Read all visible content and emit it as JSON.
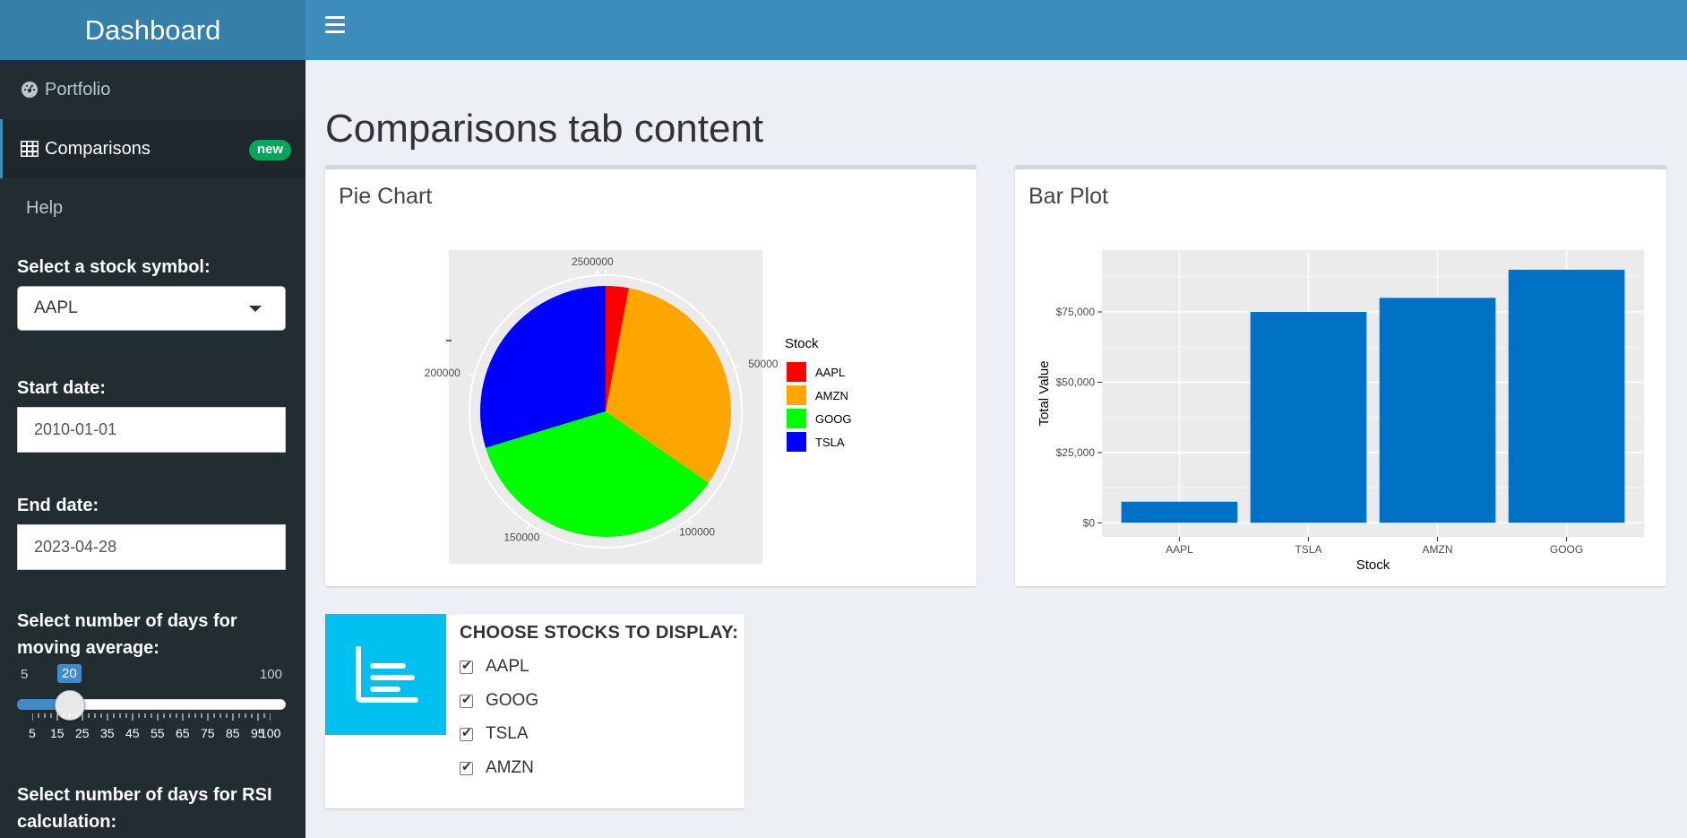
{
  "header": {
    "app_title": "Dashboard"
  },
  "sidebar": {
    "menu": [
      {
        "label": "Portfolio",
        "icon": "dashboard-icon"
      },
      {
        "label": "Comparisons",
        "icon": "table-icon",
        "badge": "new",
        "active": true
      },
      {
        "label": "Help"
      }
    ],
    "stock_select": {
      "label": "Select a stock symbol:",
      "value": "AAPL"
    },
    "start_date": {
      "label": "Start date:",
      "value": "2010-01-01"
    },
    "end_date": {
      "label": "End date:",
      "value": "2023-04-28"
    },
    "ma_slider": {
      "label": "Select number of days for moving average:",
      "min": "5",
      "max": "100",
      "value": "20",
      "ticks": [
        "5",
        "15",
        "25",
        "35",
        "45",
        "55",
        "65",
        "75",
        "85",
        "95",
        "100"
      ]
    },
    "rsi_label": "Select number of days for RSI calculation:"
  },
  "main": {
    "page_title": "Comparisons tab content",
    "pie_box": {
      "title": "Pie Chart"
    },
    "bar_box": {
      "title": "Bar Plot"
    },
    "choose_box": {
      "title": "CHOOSE STOCKS TO DISPLAY:",
      "icon": "list-icon",
      "options": [
        {
          "label": "AAPL",
          "checked": true
        },
        {
          "label": "GOOG",
          "checked": true
        },
        {
          "label": "TSLA",
          "checked": true
        },
        {
          "label": "AMZN",
          "checked": true
        }
      ]
    }
  },
  "chart_data": [
    {
      "type": "pie",
      "legend_title": "Stock",
      "legend_position": "right",
      "slices": [
        {
          "label": "AAPL",
          "value": 7500,
          "color": "#ff0000"
        },
        {
          "label": "AMZN",
          "value": 80000,
          "color": "#ffa500"
        },
        {
          "label": "GOOG",
          "value": 90000,
          "color": "#00ff00"
        },
        {
          "label": "TSLA",
          "value": 75000,
          "color": "#0000ff"
        }
      ],
      "radial_tick_labels": [
        "250000",
        "0",
        "50000",
        "100000",
        "150000",
        "200000"
      ],
      "radial_ticks": [
        0,
        50000,
        100000,
        150000,
        200000,
        250000
      ],
      "total": 252500
    },
    {
      "type": "bar",
      "categories": [
        "AAPL",
        "TSLA",
        "AMZN",
        "GOOG"
      ],
      "values": [
        7500,
        75000,
        80000,
        90000
      ],
      "color": "#0072c6",
      "xlabel": "Stock",
      "ylabel": "Total Value",
      "ylim": [
        -5000,
        97000
      ],
      "yticks": [
        0,
        25000,
        50000,
        75000
      ],
      "ytick_labels": [
        "$0",
        "$25,000",
        "$50,000",
        "$75,000"
      ],
      "grid": true
    }
  ]
}
